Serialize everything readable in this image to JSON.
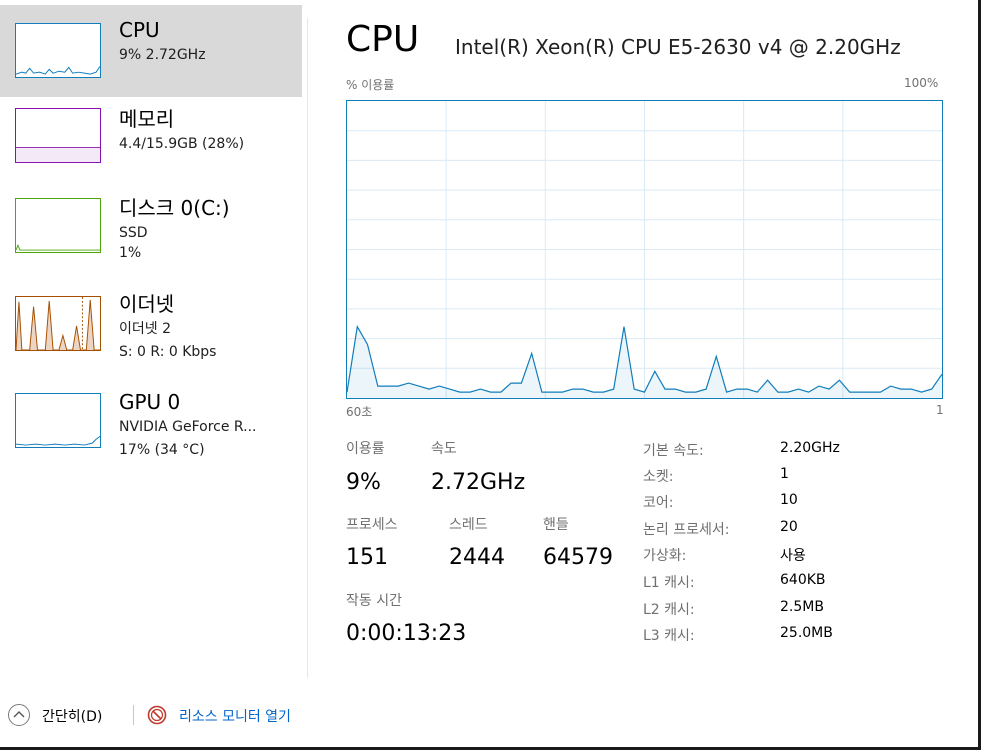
{
  "sidebar": {
    "items": [
      {
        "title": "CPU",
        "line1": "9% 2.72GHz",
        "line2": "",
        "color": "#117dbb"
      },
      {
        "title": "메모리",
        "line1": "4.4/15.9GB (28%)",
        "line2": "",
        "color": "#8b12ae"
      },
      {
        "title": "디스크 0(C:)",
        "line1": "SSD",
        "line2": "1%",
        "color": "#4da60c"
      },
      {
        "title": "이더넷",
        "line1": "이더넷 2",
        "line2": "S: 0 R: 0 Kbps",
        "color": "#a74f01"
      },
      {
        "title": "GPU 0",
        "line1": "NVIDIA GeForce R...",
        "line2": "17% (34 °C)",
        "color": "#117dbb"
      }
    ]
  },
  "header": {
    "title": "CPU",
    "model": "Intel(R) Xeon(R) CPU E5-2630 v4 @ 2.20GHz"
  },
  "graph": {
    "top_left": "% 이용률",
    "top_right": "100%",
    "bottom_left": "60초",
    "bottom_right": "1",
    "color": "#117dbb",
    "values": [
      2,
      24,
      18,
      4,
      4,
      4,
      5,
      4,
      3,
      4,
      3,
      2,
      2,
      3,
      2,
      2,
      5,
      5,
      15,
      2,
      2,
      2,
      3,
      3,
      2,
      2,
      3,
      24,
      3,
      2,
      9,
      3,
      3,
      2,
      2,
      3,
      14,
      2,
      3,
      3,
      2,
      6,
      2,
      2,
      3,
      2,
      4,
      3,
      6,
      2,
      2,
      2,
      2,
      4,
      3,
      3,
      2,
      3,
      8
    ]
  },
  "stats": {
    "utilization_label": "이용률",
    "utilization_value": "9%",
    "speed_label": "속도",
    "speed_value": "2.72GHz",
    "processes_label": "프로세스",
    "processes_value": "151",
    "threads_label": "스레드",
    "threads_value": "2444",
    "handles_label": "핸들",
    "handles_value": "64579",
    "uptime_label": "작동 시간",
    "uptime_value": "0:00:13:23"
  },
  "info": [
    {
      "label": "기본 속도:",
      "value": "2.20GHz"
    },
    {
      "label": "소켓:",
      "value": "1"
    },
    {
      "label": "코어:",
      "value": "10"
    },
    {
      "label": "논리 프로세서:",
      "value": "20"
    },
    {
      "label": "가상화:",
      "value": "사용"
    },
    {
      "label": "L1 캐시:",
      "value": "640KB"
    },
    {
      "label": "L2 캐시:",
      "value": "2.5MB"
    },
    {
      "label": "L3 캐시:",
      "value": "25.0MB"
    }
  ],
  "footer": {
    "collapse_label": "간단히(D)",
    "monitor_label": "리소스 모니터 열기",
    "link_color": "#0066cc"
  }
}
